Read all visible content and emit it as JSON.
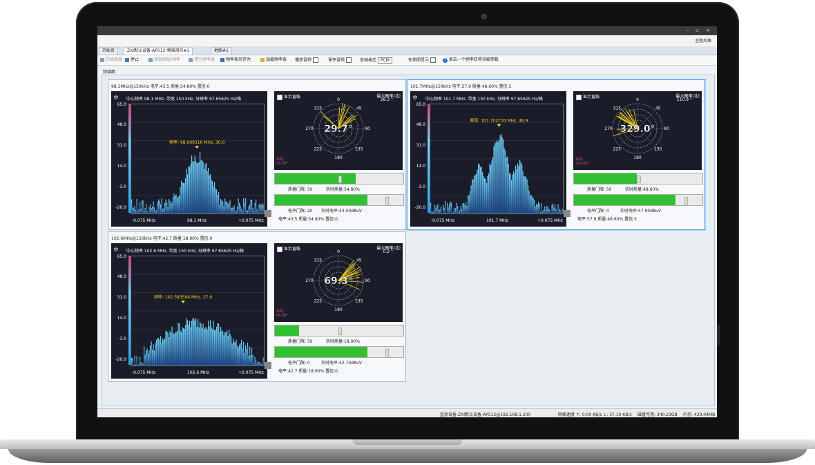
{
  "window": {
    "controls": "– ▫ ×"
  },
  "ribbon": {
    "brand": "主题风格"
  },
  "tabs": [
    "开始页",
    "ZXI默认设备-AP512-频谱测向#1",
    "地图#1"
  ],
  "toolbar": {
    "items": [
      {
        "label": "开始测量",
        "enabled": false,
        "icon": "play-icon"
      },
      {
        "label": "停止",
        "enabled": true,
        "icon": "stop-icon"
      },
      {
        "label": "添加频段/频率",
        "enabled": false,
        "icon": "plus-icon"
      },
      {
        "label": "清空频率表",
        "enabled": false,
        "icon": "clear-icon"
      },
      {
        "label": "频率表另存为",
        "enabled": true,
        "icon": "save-icon"
      },
      {
        "label": "加载频率表",
        "enabled": true,
        "icon": "folder-icon"
      }
    ],
    "play_audio": "播放音频",
    "save_audio": "保存音频",
    "audio_format_label": "音频格式",
    "audio_format": "PCM",
    "map_show": "在地图显示",
    "hint": "单击一个频率获得详细参数"
  },
  "page_label": "频谱面",
  "status": {
    "device": "监测设备:ZXI默认设备-AP512@192.168.1.200",
    "network": "网络速度 ↑: 0.00 KB/s ↓: 37.10 KB/s",
    "disk": "磁盘可用: 340.23GB",
    "memory": "内存: 429.04MB"
  },
  "panels": [
    {
      "header": "98.1MHz@150kHz   电平:43.5  质量:54.80%  置信:0",
      "spectrum": {
        "info": "中心频率 98.1 MHz, 带宽 150 kHz, 分辨率 97.65625 Hz/格",
        "y_ticks": [
          "65.0",
          "48.0",
          "31.0",
          "14.0",
          "-3.0",
          "-20.0"
        ],
        "marker": "频率: 98.099316 MHz, 30.0",
        "marker_freq": 98.099316,
        "marker_level": 30.0,
        "shape": "narrow",
        "x_labels": [
          "-0.075 MHz",
          "98.1 MHz",
          "+0.075 MHz"
        ]
      },
      "direction": {
        "show_line": "显示直线",
        "max_label": "最大概率(北)",
        "max_value": "28.3 °",
        "bearing": "29.7°",
        "bearing_deg": 29.7,
        "realtime": "实时:",
        "realtime_value": "29.70°"
      },
      "bars": {
        "quality_fill": 0.63,
        "level_fill": 0.72,
        "quality_gate": "质量门限: 50",
        "realtime_quality": "实时质量:54.80%",
        "level_gate": "电平门限: 20",
        "realtime_level": "实时电平:43.50dBuV",
        "footer": "电平:43.5  质量:54.80%  置信:0"
      }
    },
    {
      "header": "101.7MHz@150kHz   电平:57.9  质量:48.60%  置信:5",
      "spectrum": {
        "info": "中心频率 101.7 MHz, 带宽 150 kHz, 分辨率 97.65625 Hz/格",
        "y_ticks": [
          "65.0",
          "48.0",
          "31.0",
          "14.0",
          "-3.0",
          "-20.0"
        ],
        "marker": "频率: 101.702734 MHz, 46.9",
        "marker_freq": 101.702734,
        "marker_level": 46.9,
        "shape": "multi",
        "x_labels": [
          "-0.075 MHz",
          "101.7 MHz",
          "+0.075 MHz"
        ]
      },
      "direction": {
        "show_line": "显示直线",
        "max_label": "最大概率(北)",
        "max_value": "110.9 °",
        "bearing": "329.0°",
        "bearing_deg": 329.0,
        "realtime": "实时:",
        "realtime_value": "329.00°"
      },
      "bars": {
        "quality_fill": 0.49,
        "level_fill": 0.79,
        "quality_gate": "质量门限: 50",
        "realtime_quality": "实时质量:48.60%",
        "level_gate": "电平门限: 0",
        "realtime_level": "实时电平:57.90dBuV",
        "footer": "电平:57.9  质量:48.60%  置信:5"
      }
    },
    {
      "header": "102.6MHz@150kHz   电平:42.7  质量:18.90%  置信:0",
      "spectrum": {
        "info": "中心频率 102.6 MHz, 带宽 150 kHz, 分辨率 97.65625 Hz/格",
        "y_ticks": [
          "65.0",
          "48.0",
          "31.0",
          "14.0",
          "-3.0",
          "-20.0"
        ],
        "marker": "频率: 102.583594 MHz, 27.9",
        "marker_freq": 102.583594,
        "marker_level": 27.9,
        "shape": "wide",
        "x_labels": [
          "-0.075 MHz",
          "102.6 MHz",
          "+0.075 MHz"
        ]
      },
      "direction": {
        "show_line": "显示直线",
        "max_label": "最大概率(北)",
        "max_value": "0.2 °",
        "bearing": "69.3°",
        "bearing_deg": 69.3,
        "realtime": "实时:",
        "realtime_value": "69.30°"
      },
      "bars": {
        "quality_fill": 0.19,
        "level_fill": 0.72,
        "quality_gate": "质量门限: 50",
        "realtime_quality": "实时质量:18.90%",
        "level_gate": "电平门限: 0",
        "realtime_level": "实时电平:42.70dBuV",
        "footer": "电平:42.7  质量:18.90%  置信:0"
      }
    }
  ],
  "colors": {
    "spectrum_bg": "#1a1d29",
    "bar_light": "#6fd6ff",
    "bar_dark": "#1e4f96",
    "marker": "#f2d21b",
    "progress": "#2fc12f",
    "selected_border": "#4aa3e8"
  }
}
